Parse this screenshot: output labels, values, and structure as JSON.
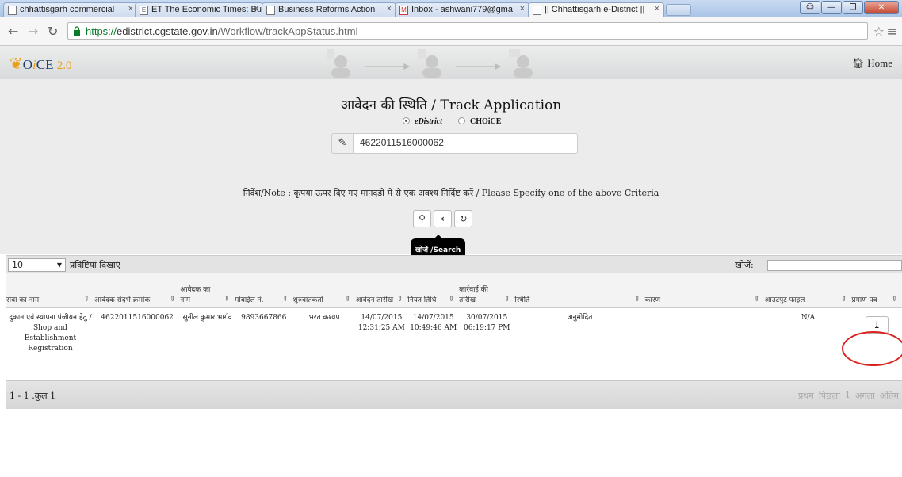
{
  "browser": {
    "tabs": [
      {
        "label": "chhattisgarh commercial"
      },
      {
        "label": "ET The Economic Times: Busi"
      },
      {
        "label": "Business Reforms Action"
      },
      {
        "label": "Inbox - ashwani779@gma"
      },
      {
        "label": "|| Chhattisgarh e-District ||"
      }
    ],
    "url_scheme": "https://",
    "url_host": "edistrict.cgstate.gov.in",
    "url_path": "/Workflow/trackAppStatus.html"
  },
  "header": {
    "logo_o": "O",
    "logo_i": "i",
    "logo_ce": "CE",
    "logo_ver": "2.0",
    "home_label": "Home"
  },
  "main": {
    "title": "आवेदन की स्थिति / Track Application",
    "radio_edistrict": "eDistrict",
    "radio_choice": "CHOiCE",
    "app_number": "4622011516000062",
    "note": "निर्देश/Note : कृपया ऊपर दिए गए मानदंडो में से एक अवश्य निर्दिष्ट करें / Please Specify one of the above Criteria",
    "tooltip": "खोजें /Search"
  },
  "table_controls": {
    "page_length": "10",
    "length_label": "प्रविष्टियां दिखाएं",
    "search_label": "खोजें:"
  },
  "table": {
    "columns": [
      "सेवा का नाम",
      "आवेदक संदर्भ क्रमांक",
      "आवेदक का नाम",
      "मोबाईल नं.",
      "शुरुवातकर्ता",
      "आवेदन तारीख",
      "नियत तिथि",
      "कार्रवाई की तारीख",
      "स्थिति",
      "कारण",
      "आउटपुट फाइल",
      "प्रमाण पत्र"
    ],
    "rows": [
      {
        "service_hi": "दुकान एवं स्थापना पंजीयन हेतु",
        "service_sep": " / ",
        "service_en": "Shop and Establishment Registration",
        "ref_no": "4622011516000062",
        "name": "सुनील कुमार भार्गव",
        "mobile": "9893667866",
        "initiator": "भरत कश्यप",
        "app_date": "14/07/2015",
        "app_time": "12:31:25 AM",
        "due_date": "14/07/2015",
        "due_time": "10:49:46 AM",
        "action_date": "30/07/2015",
        "action_time": "06:19:17 PM",
        "status": "अनुमोदित",
        "reason": "",
        "output_file": "N/A"
      }
    ]
  },
  "footer": {
    "info": "1 - 1 .कुल 1",
    "pager_first": "प्रथम",
    "pager_prev": "पिछला",
    "pager_page": "1",
    "pager_next": "अगला",
    "pager_last": "अंतिम"
  }
}
